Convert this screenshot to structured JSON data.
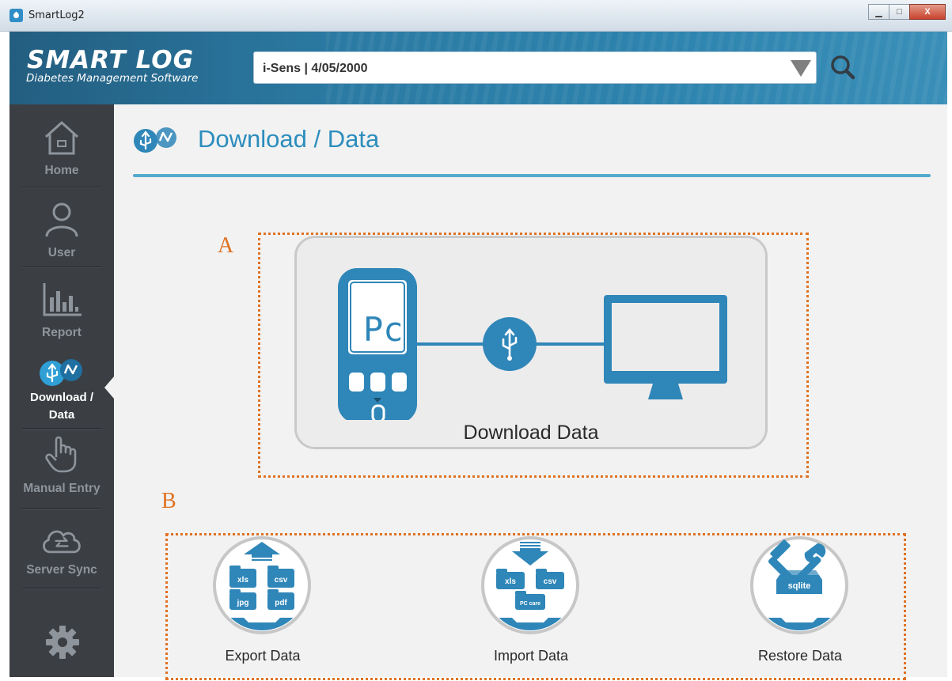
{
  "window": {
    "title": "SmartLog2",
    "minimize_glyph": "▁",
    "maximize_glyph": "□",
    "close_glyph": "X"
  },
  "header": {
    "logo_main": "SMART LOG",
    "logo_sub": "Diabetes Management Software",
    "patient_selector": {
      "value": "i-Sens | 4/05/2000"
    },
    "search_icon": "search-icon"
  },
  "sidebar": {
    "items": [
      {
        "label": "Home",
        "icon": "home-icon"
      },
      {
        "label": "User",
        "icon": "user-icon"
      },
      {
        "label": "Report",
        "icon": "bar-chart-icon"
      },
      {
        "label": "Download /\nData",
        "label_line1": "Download /",
        "label_line2": "Data",
        "icon": "usb-download-icon",
        "active": true
      },
      {
        "label": "Manual Entry",
        "icon": "hand-pointer-icon"
      },
      {
        "label": "Server Sync",
        "icon": "cloud-sync-icon"
      }
    ],
    "settings_icon": "gear-icon"
  },
  "main": {
    "page_title": "Download / Data",
    "section_a_letter": "A",
    "section_b_letter": "B",
    "download_card": {
      "label": "Download Data",
      "meter_display_text": "Pc"
    },
    "tools": [
      {
        "label": "Export Data",
        "icon": "export-data-icon",
        "files": [
          "xls",
          "csv",
          "jpg",
          "pdf"
        ]
      },
      {
        "label": "Import Data",
        "icon": "import-data-icon",
        "files": [
          "xls",
          "csv",
          "PC care"
        ]
      },
      {
        "label": "Restore Data",
        "icon": "restore-data-icon",
        "files": [
          "sqlite"
        ]
      }
    ]
  },
  "colors": {
    "accent_blue": "#2c8dbd",
    "icon_blue": "#2f86b8",
    "annotation_orange": "#e07222",
    "sidebar_bg": "#3b3f44",
    "active_indicator": "#2ba6de"
  }
}
